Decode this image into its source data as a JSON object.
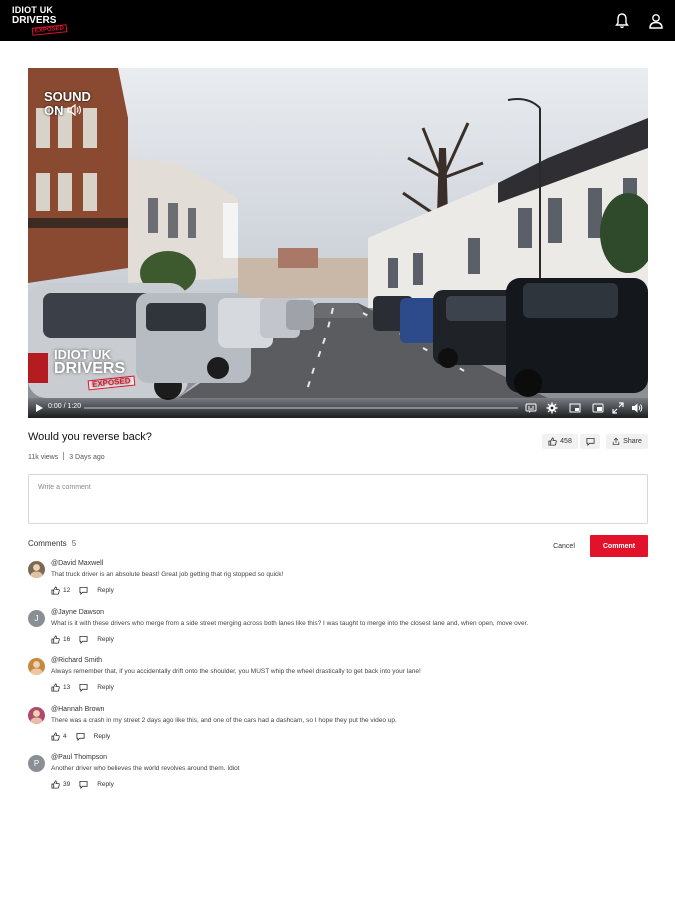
{
  "brand": {
    "logo_line1": "IDIOT UK",
    "logo_line2": "DRIVERS",
    "logo_tag": "EXPOSED"
  },
  "video": {
    "overlay_sound_line1": "SOUND",
    "overlay_sound_line2": "ON",
    "watermark_line1": "IDIOT UK",
    "watermark_line2": "DRIVERS",
    "watermark_tag": "EXPOSED",
    "timecode": "0:00 / 1:20",
    "progress": 0.0
  },
  "title": "Would you reverse back?",
  "views": "11k views",
  "posted": "3 Days ago",
  "actions": {
    "likes": "458",
    "share_label": "Share"
  },
  "comment_input": {
    "placeholder": "Write a comment"
  },
  "comments_section": {
    "label": "Comments",
    "count": "5",
    "cancel_label": "Cancel",
    "submit_label": "Comment"
  },
  "comments": [
    {
      "author": "@David Maxwell",
      "text": "That truck driver is an absolute beast! Great job getting that rig stopped so quick!",
      "likes": "12",
      "reply_label": "Reply",
      "avatar_color": "#7a6a55"
    },
    {
      "author": "@Jayne Dawson",
      "text": "What is it with these drivers who merge from a side street merging across both lanes like this? I was taught to merge into the closest lane and, when open, move over.",
      "likes": "16",
      "reply_label": "Reply",
      "avatar_letter": "J",
      "avatar_color": "#8a8f96"
    },
    {
      "author": "@Richard Smith",
      "text": "Always remember that, if you accidentally drift onto the shoulder, you MUST whip the wheel drastically to get back into your lane!",
      "likes": "13",
      "reply_label": "Reply",
      "avatar_color": "#c58a3f"
    },
    {
      "author": "@Hannah Brown",
      "text": "There was a crash in my street 2 days ago like this, and one of the cars had a dashcam, so I hope they put the video up.",
      "likes": "4",
      "reply_label": "Reply",
      "avatar_color": "#b04a6a"
    },
    {
      "author": "@Paul Thompson",
      "text": "Another driver who believes the world revolves around them. Idiot",
      "likes": "39",
      "reply_label": "Reply",
      "avatar_letter": "P",
      "avatar_color": "#8a8f96"
    }
  ]
}
